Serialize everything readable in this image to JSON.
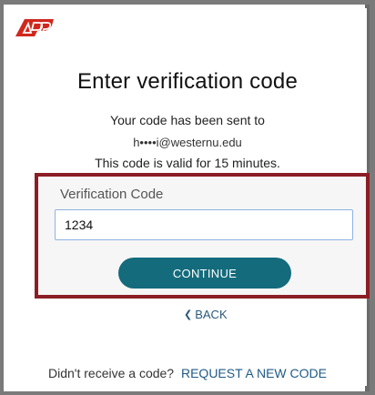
{
  "brand": {
    "logo_text": "ADP",
    "color": "#d0271d"
  },
  "title": "Enter verification code",
  "info": {
    "sent_to_text": "Your code has been sent to",
    "email": "h••••i@westernu.edu",
    "validity_text": "This code is valid for 15 minutes."
  },
  "form": {
    "label": "Verification Code",
    "value": "1234",
    "button_label": "CONTINUE",
    "back_label": "BACK",
    "back_icon": "chevron-left-icon"
  },
  "footer": {
    "prompt": "Didn't receive a code?",
    "link": "REQUEST A NEW CODE"
  },
  "colors": {
    "highlight": "#8b1e24",
    "button": "#136b7c",
    "link": "#1f5a86"
  }
}
